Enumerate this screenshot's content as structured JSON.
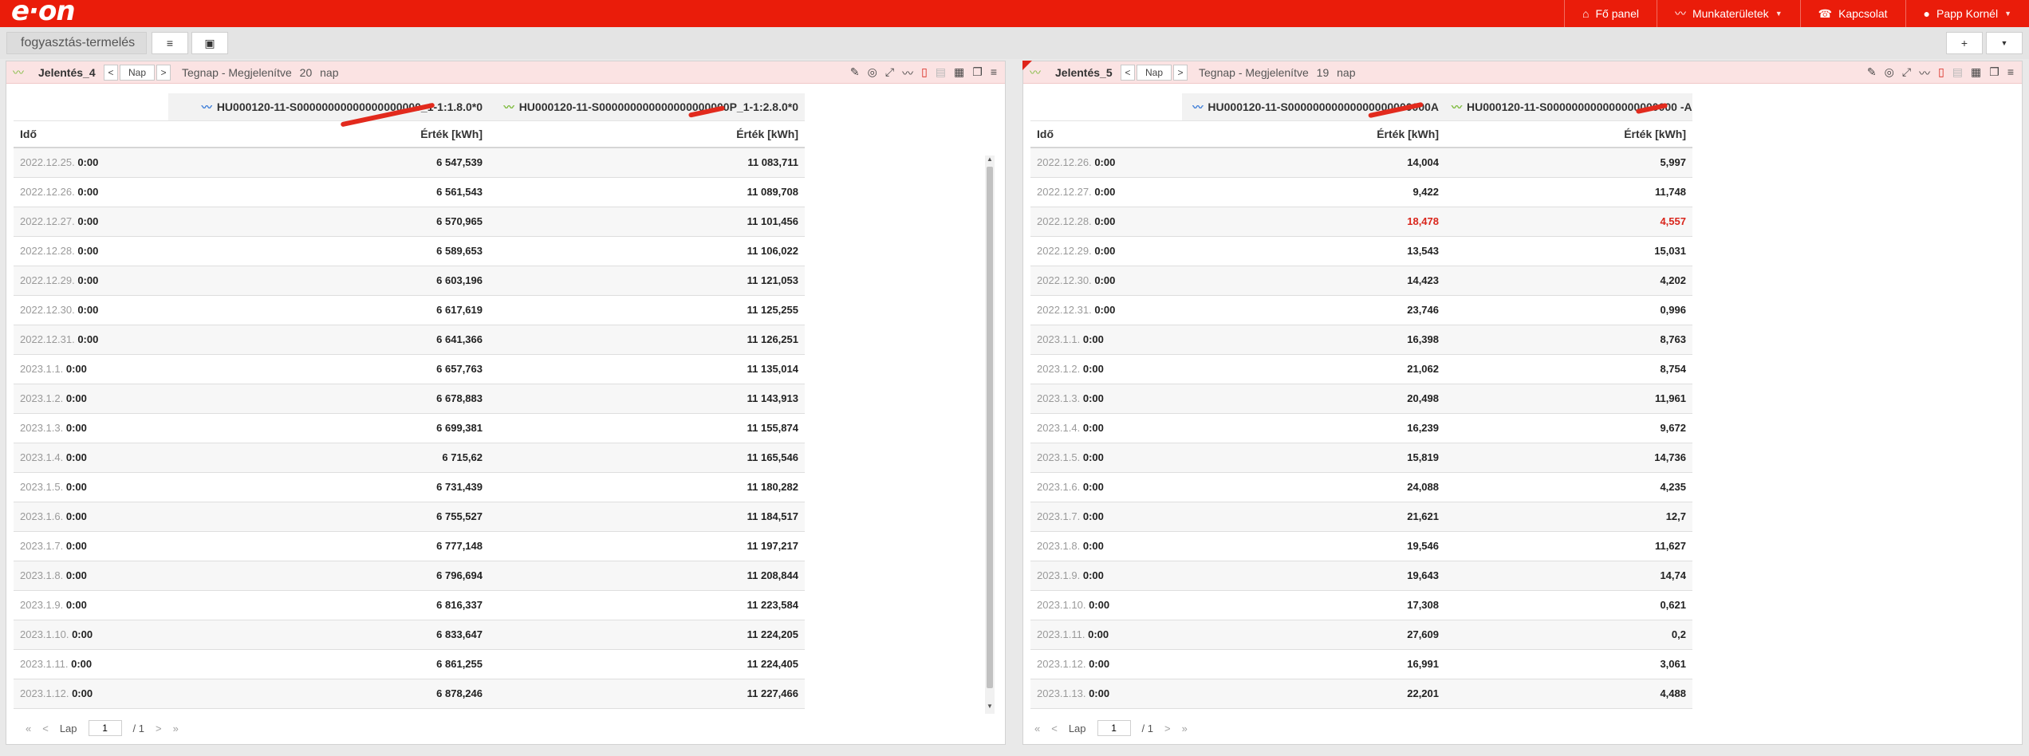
{
  "brand": "e·on",
  "nav": [
    {
      "icon": "home-icon",
      "glyph": "⌂",
      "label": "Fő panel",
      "caret": false
    },
    {
      "icon": "chart-icon",
      "glyph": "〰",
      "label": "Munkaterületek",
      "caret": true
    },
    {
      "icon": "contact-icon",
      "glyph": "☎",
      "label": "Kapcsolat",
      "caret": false
    },
    {
      "icon": "user-icon",
      "glyph": "👤",
      "label": "Papp Kornél",
      "caret": true
    }
  ],
  "workspace_tab": "fogyasztás-termelés",
  "toolbar": {
    "menu": "≡",
    "save": "💾",
    "add": "+",
    "more": "▼"
  },
  "panels": [
    {
      "title": "Jelentés_4",
      "period": "Nap",
      "prev": "<",
      "next": ">",
      "info_label": "Tegnap - Megjelenítve",
      "info_count": "20",
      "info_unit": "nap",
      "series": [
        {
          "label": "HU000120-11-S00000000000000000000_1-1:1.8.0*0",
          "color": "blue"
        },
        {
          "label": "HU000120-11-S000000000000000000000P_1-1:2.8.0*0",
          "color": "green"
        }
      ],
      "headers": [
        "Idő",
        "Érték [kWh]",
        "Érték [kWh]"
      ],
      "rows": [
        {
          "date": "2022.12.25.",
          "time": "0:00",
          "v1": "6 547,539",
          "v2": "11 083,711"
        },
        {
          "date": "2022.12.26.",
          "time": "0:00",
          "v1": "6 561,543",
          "v2": "11 089,708"
        },
        {
          "date": "2022.12.27.",
          "time": "0:00",
          "v1": "6 570,965",
          "v2": "11 101,456"
        },
        {
          "date": "2022.12.28.",
          "time": "0:00",
          "v1": "6 589,653",
          "v2": "11 106,022"
        },
        {
          "date": "2022.12.29.",
          "time": "0:00",
          "v1": "6 603,196",
          "v2": "11 121,053"
        },
        {
          "date": "2022.12.30.",
          "time": "0:00",
          "v1": "6 617,619",
          "v2": "11 125,255"
        },
        {
          "date": "2022.12.31.",
          "time": "0:00",
          "v1": "6 641,366",
          "v2": "11 126,251"
        },
        {
          "date": "2023.1.1.",
          "time": "0:00",
          "v1": "6 657,763",
          "v2": "11 135,014"
        },
        {
          "date": "2023.1.2.",
          "time": "0:00",
          "v1": "6 678,883",
          "v2": "11 143,913"
        },
        {
          "date": "2023.1.3.",
          "time": "0:00",
          "v1": "6 699,381",
          "v2": "11 155,874"
        },
        {
          "date": "2023.1.4.",
          "time": "0:00",
          "v1": "6 715,62",
          "v2": "11 165,546"
        },
        {
          "date": "2023.1.5.",
          "time": "0:00",
          "v1": "6 731,439",
          "v2": "11 180,282"
        },
        {
          "date": "2023.1.6.",
          "time": "0:00",
          "v1": "6 755,527",
          "v2": "11 184,517"
        },
        {
          "date": "2023.1.7.",
          "time": "0:00",
          "v1": "6 777,148",
          "v2": "11 197,217"
        },
        {
          "date": "2023.1.8.",
          "time": "0:00",
          "v1": "6 796,694",
          "v2": "11 208,844"
        },
        {
          "date": "2023.1.9.",
          "time": "0:00",
          "v1": "6 816,337",
          "v2": "11 223,584"
        },
        {
          "date": "2023.1.10.",
          "time": "0:00",
          "v1": "6 833,647",
          "v2": "11 224,205"
        },
        {
          "date": "2023.1.11.",
          "time": "0:00",
          "v1": "6 861,255",
          "v2": "11 224,405"
        },
        {
          "date": "2023.1.12.",
          "time": "0:00",
          "v1": "6 878,246",
          "v2": "11 227,466"
        }
      ],
      "pager": {
        "first": "«",
        "prev": "<",
        "label": "Lap",
        "page": "1",
        "total": "/ 1",
        "next": ">",
        "last": "»"
      }
    },
    {
      "title": "Jelentés_5",
      "period": "Nap",
      "prev": "<",
      "next": ">",
      "info_label": "Tegnap - Megjelenítve",
      "info_count": "19",
      "info_unit": "nap",
      "series": [
        {
          "label": "HU000120-11-S00000000000000000000000A",
          "color": "blue"
        },
        {
          "label": "HU000120-11-S000000000000000000000 -A",
          "color": "green"
        }
      ],
      "headers": [
        "Idő",
        "Érték [kWh]",
        "Érték [kWh]"
      ],
      "rows": [
        {
          "date": "2022.12.26.",
          "time": "0:00",
          "v1": "14,004",
          "v2": "5,997"
        },
        {
          "date": "2022.12.27.",
          "time": "0:00",
          "v1": "9,422",
          "v2": "11,748"
        },
        {
          "date": "2022.12.28.",
          "time": "0:00",
          "v1": "18,478",
          "v2": "4,557",
          "highlight": true
        },
        {
          "date": "2022.12.29.",
          "time": "0:00",
          "v1": "13,543",
          "v2": "15,031"
        },
        {
          "date": "2022.12.30.",
          "time": "0:00",
          "v1": "14,423",
          "v2": "4,202"
        },
        {
          "date": "2022.12.31.",
          "time": "0:00",
          "v1": "23,746",
          "v2": "0,996"
        },
        {
          "date": "2023.1.1.",
          "time": "0:00",
          "v1": "16,398",
          "v2": "8,763"
        },
        {
          "date": "2023.1.2.",
          "time": "0:00",
          "v1": "21,062",
          "v2": "8,754"
        },
        {
          "date": "2023.1.3.",
          "time": "0:00",
          "v1": "20,498",
          "v2": "11,961"
        },
        {
          "date": "2023.1.4.",
          "time": "0:00",
          "v1": "16,239",
          "v2": "9,672"
        },
        {
          "date": "2023.1.5.",
          "time": "0:00",
          "v1": "15,819",
          "v2": "14,736"
        },
        {
          "date": "2023.1.6.",
          "time": "0:00",
          "v1": "24,088",
          "v2": "4,235"
        },
        {
          "date": "2023.1.7.",
          "time": "0:00",
          "v1": "21,621",
          "v2": "12,7"
        },
        {
          "date": "2023.1.8.",
          "time": "0:00",
          "v1": "19,546",
          "v2": "11,627"
        },
        {
          "date": "2023.1.9.",
          "time": "0:00",
          "v1": "19,643",
          "v2": "14,74"
        },
        {
          "date": "2023.1.10.",
          "time": "0:00",
          "v1": "17,308",
          "v2": "0,621"
        },
        {
          "date": "2023.1.11.",
          "time": "0:00",
          "v1": "27,609",
          "v2": "0,2"
        },
        {
          "date": "2023.1.12.",
          "time": "0:00",
          "v1": "16,991",
          "v2": "3,061"
        },
        {
          "date": "2023.1.13.",
          "time": "0:00",
          "v1": "22,201",
          "v2": "4,488"
        }
      ],
      "pager": {
        "first": "«",
        "prev": "<",
        "label": "Lap",
        "page": "1",
        "total": "/ 1",
        "next": ">",
        "last": "»"
      }
    }
  ],
  "colors": {
    "brand": "#ea1c0a",
    "panel_header": "#fbe3e3",
    "highlight": "#d9261c",
    "series_blue": "#3d7dd8",
    "series_green": "#7dbb3c"
  }
}
